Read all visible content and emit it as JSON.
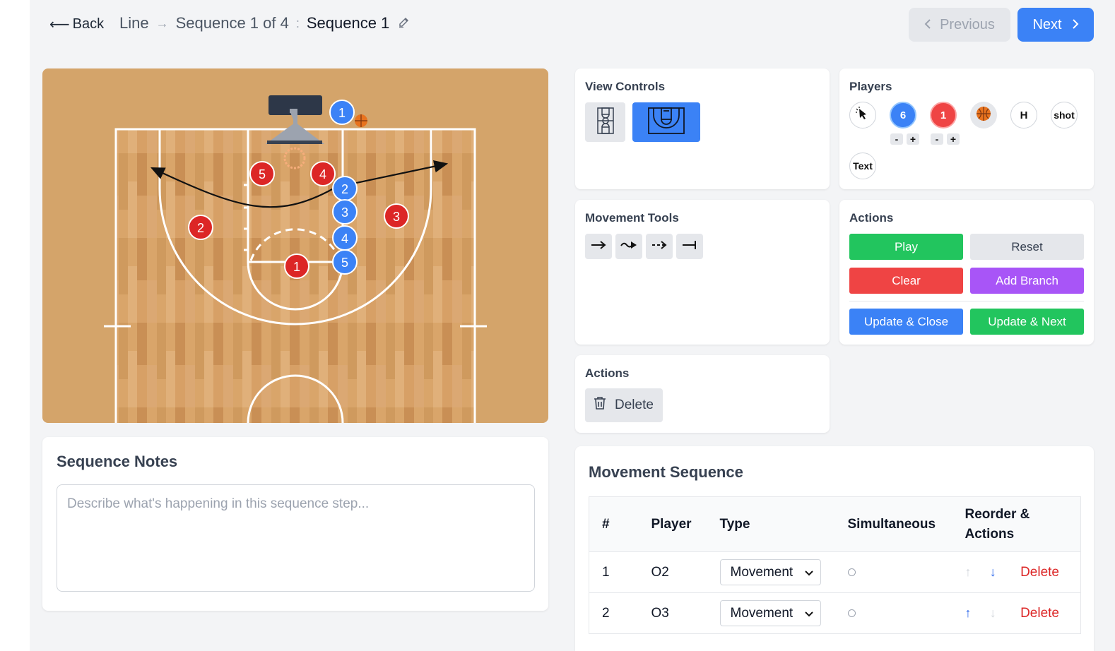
{
  "header": {
    "back_label": "Back",
    "back_arrow": "⟵",
    "crumb_line": "Line",
    "crumb_arrow": "→",
    "crumb_sequence": "Sequence 1 of 4",
    "crumb_colon": ":",
    "crumb_name": "Sequence 1",
    "prev_label": "Previous",
    "next_label": "Next"
  },
  "court": {
    "colors": {
      "floor": "#d4a46a",
      "line": "#ffffff",
      "offense": "#3b82f6",
      "defense": "#dc2626"
    },
    "offense_labels": [
      "1",
      "2",
      "3",
      "4",
      "5"
    ],
    "defense_labels": [
      "1",
      "2",
      "3",
      "4",
      "5"
    ]
  },
  "notes": {
    "title": "Sequence Notes",
    "placeholder": "Describe what's happening in this sequence step..."
  },
  "view_controls": {
    "title": "View Controls",
    "full_court_icon": "full-court-icon",
    "half_court_icon": "half-court-icon",
    "active": "half"
  },
  "players": {
    "title": "Players",
    "offense_count": "6",
    "defense_count": "1",
    "minus": "-",
    "plus": "+",
    "home_label": "H",
    "shot_label": "shot",
    "text_label": "Text"
  },
  "movement_tools": {
    "title": "Movement Tools",
    "tools": [
      "movement-arrow-icon",
      "dribble-arrow-icon",
      "pass-arrow-icon",
      "screen-icon"
    ]
  },
  "actions_right": {
    "title": "Actions",
    "play": "Play",
    "reset": "Reset",
    "clear": "Clear",
    "add_branch": "Add Branch",
    "update_close": "Update & Close",
    "update_next": "Update & Next"
  },
  "actions_middle": {
    "title": "Actions",
    "delete": "Delete"
  },
  "movement_sequence": {
    "title": "Movement Sequence",
    "headers": {
      "num": "#",
      "player": "Player",
      "type": "Type",
      "simultaneous": "Simultaneous",
      "reorder_1": "Reorder &",
      "reorder_2": "Actions"
    },
    "rows": [
      {
        "num": "1",
        "player": "O2",
        "type": "Movement",
        "delete": "Delete"
      },
      {
        "num": "2",
        "player": "O3",
        "type": "Movement",
        "delete": "Delete"
      }
    ]
  }
}
